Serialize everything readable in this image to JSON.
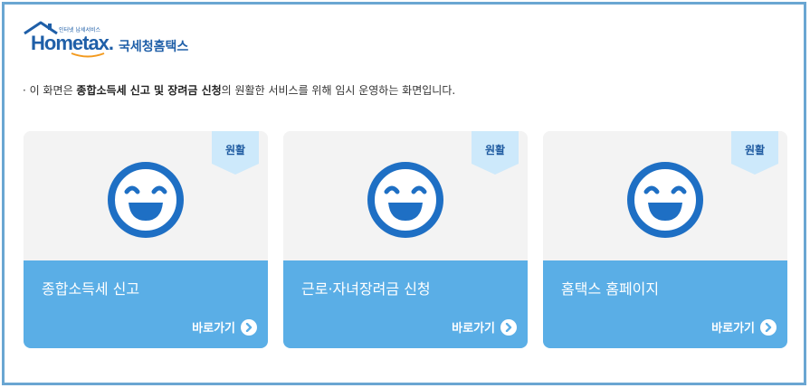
{
  "logo": {
    "small_text": "인터넷 납세서비스",
    "word": "Hometax.",
    "korean": "국세청홈택스"
  },
  "notice": {
    "prefix": "· 이 화면은 ",
    "bold": "종합소득세 신고 및 장려금 신청",
    "suffix": "의 원활한 서비스를 위해 임시 운영하는 화면입니다."
  },
  "cards": [
    {
      "badge": "원활",
      "title": "종합소득세 신고",
      "link": "바로가기"
    },
    {
      "badge": "원활",
      "title": "근로·자녀장려금 신청",
      "link": "바로가기"
    },
    {
      "badge": "원활",
      "title": "홈택스 홈페이지",
      "link": "바로가기"
    }
  ],
  "colors": {
    "border": "#6aa6d2",
    "brand": "#1f5fa8",
    "card_blue": "#5aaee6",
    "ribbon": "#cde9fb",
    "face": "#1e6fc4"
  },
  "icons": {
    "face": "smiley-face-icon",
    "arrow": "chevron-right-circle-icon"
  }
}
